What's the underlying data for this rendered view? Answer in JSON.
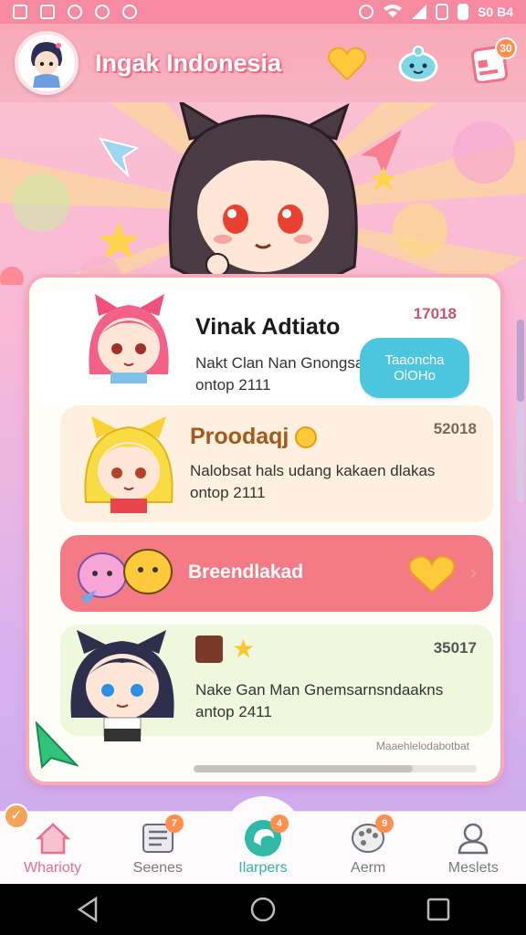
{
  "status_bar": {
    "time": "S0 B4"
  },
  "header": {
    "title": "Ingak Indonesia",
    "notif_count": "30"
  },
  "cards": [
    {
      "title": "Vinak Adtiato",
      "subtitle_line1": "Nakt Clan Nan Gnongsam",
      "subtitle_line2": "ontop 2111",
      "count": "17018",
      "button_line1": "Taaoncha",
      "button_line2": "OlOHo"
    },
    {
      "title": "Proodaqj",
      "subtitle_line1": "Nalobsat hals udang kakaen dlakas",
      "subtitle_line2": "ontop 2111",
      "count": "52018"
    },
    {
      "banner_label": "Breendlakad"
    },
    {
      "subtitle_line1": "Nake Gan Man Gnemsarnsndaakns",
      "subtitle_line2": "antop 2411",
      "count": "35017"
    }
  ],
  "footer_note": "Maaehlelodabotbat",
  "bottom_nav": [
    {
      "label": "Wharioty",
      "badge": ""
    },
    {
      "label": "Seenes",
      "badge": "7"
    },
    {
      "label": "Ilarpers",
      "badge": "4"
    },
    {
      "label": "Aerm",
      "badge": "9"
    },
    {
      "label": "Meslets",
      "badge": ""
    }
  ],
  "colors": {
    "header_pink": "#f8a8b6",
    "accent_teal": "#35b3a6",
    "follow_blue": "#4cc6de",
    "banner_coral": "#f47b86"
  }
}
